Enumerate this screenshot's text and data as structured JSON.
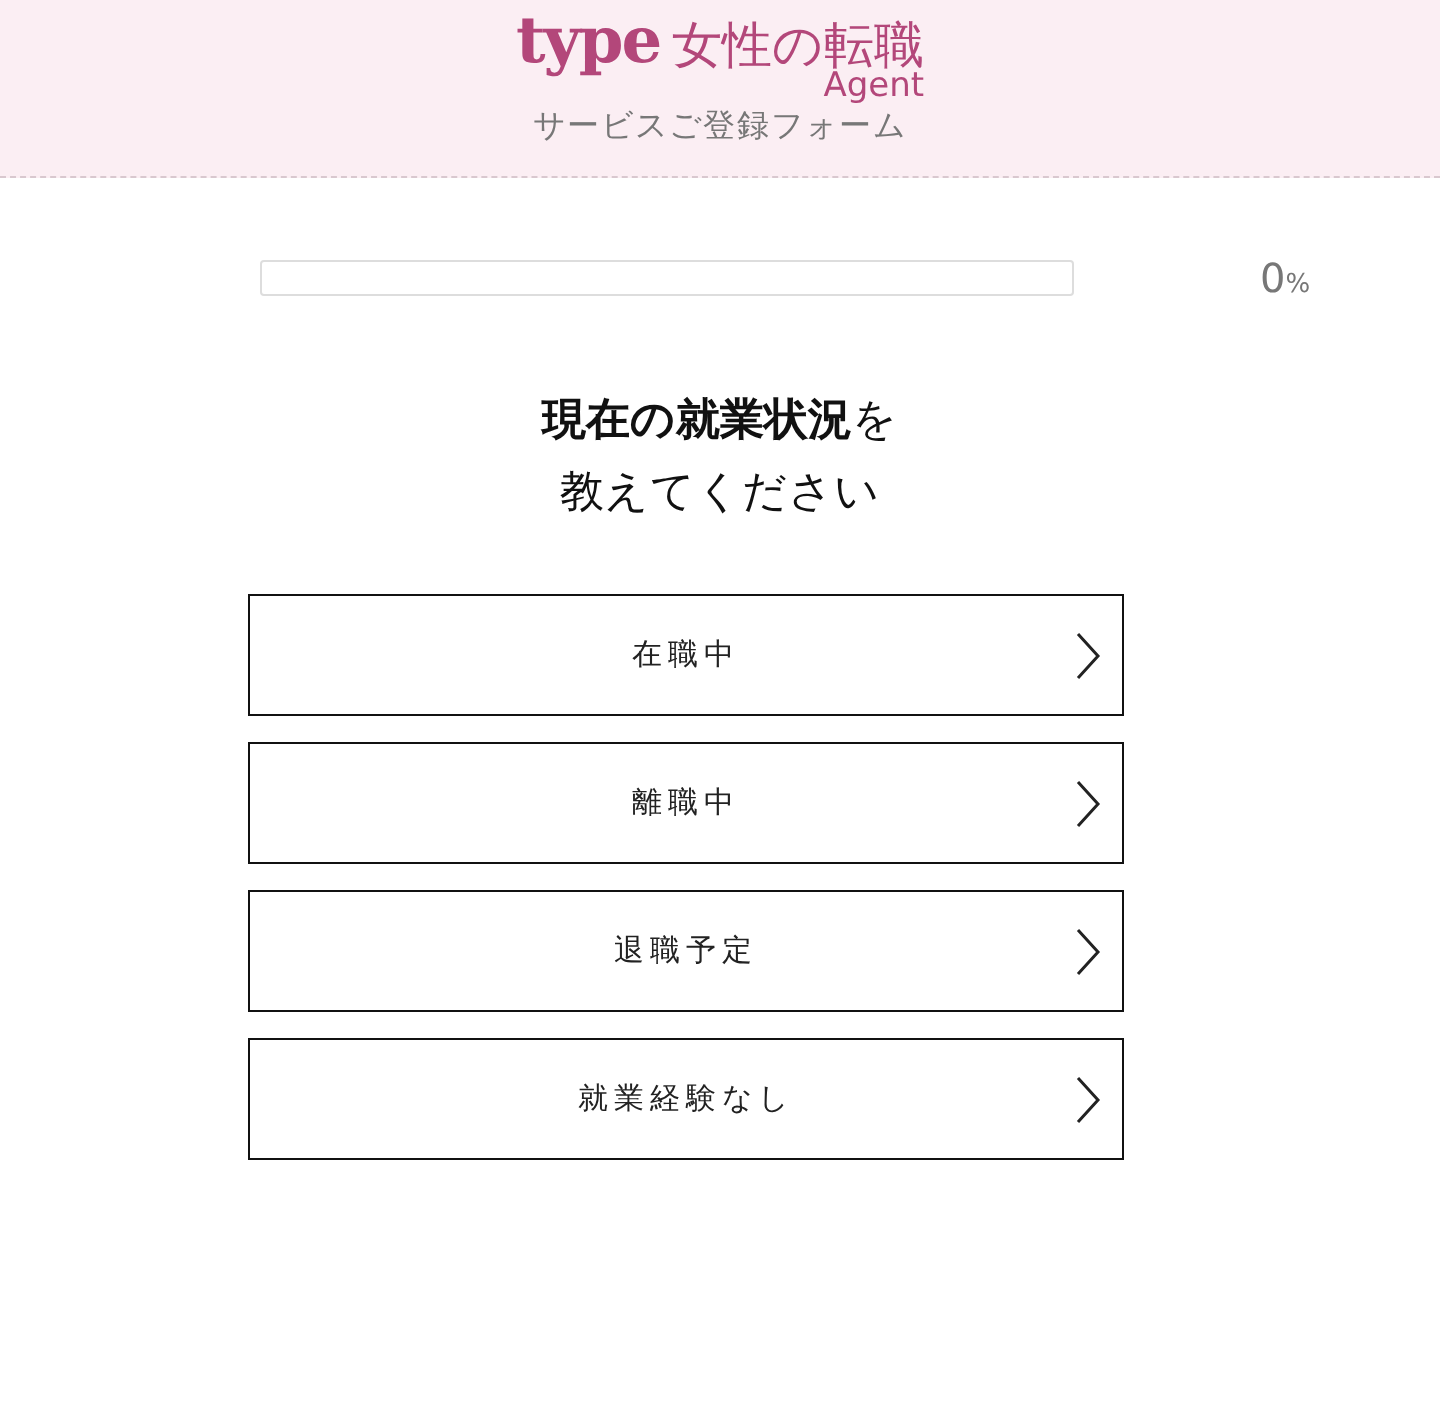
{
  "header": {
    "logo_word": "type",
    "logo_title": "女性の転職",
    "logo_sub": "Agent",
    "subtitle": "サービスご登録フォーム"
  },
  "progress": {
    "level": 0,
    "value": "0",
    "unit": "%"
  },
  "question_lines": [
    "**現在の就業状況**を",
    "教えてください"
  ],
  "options": [
    {
      "label": "在職中"
    },
    {
      "label": "離職中"
    },
    {
      "label": "退職予定"
    },
    {
      "label": "就業経験なし"
    }
  ]
}
